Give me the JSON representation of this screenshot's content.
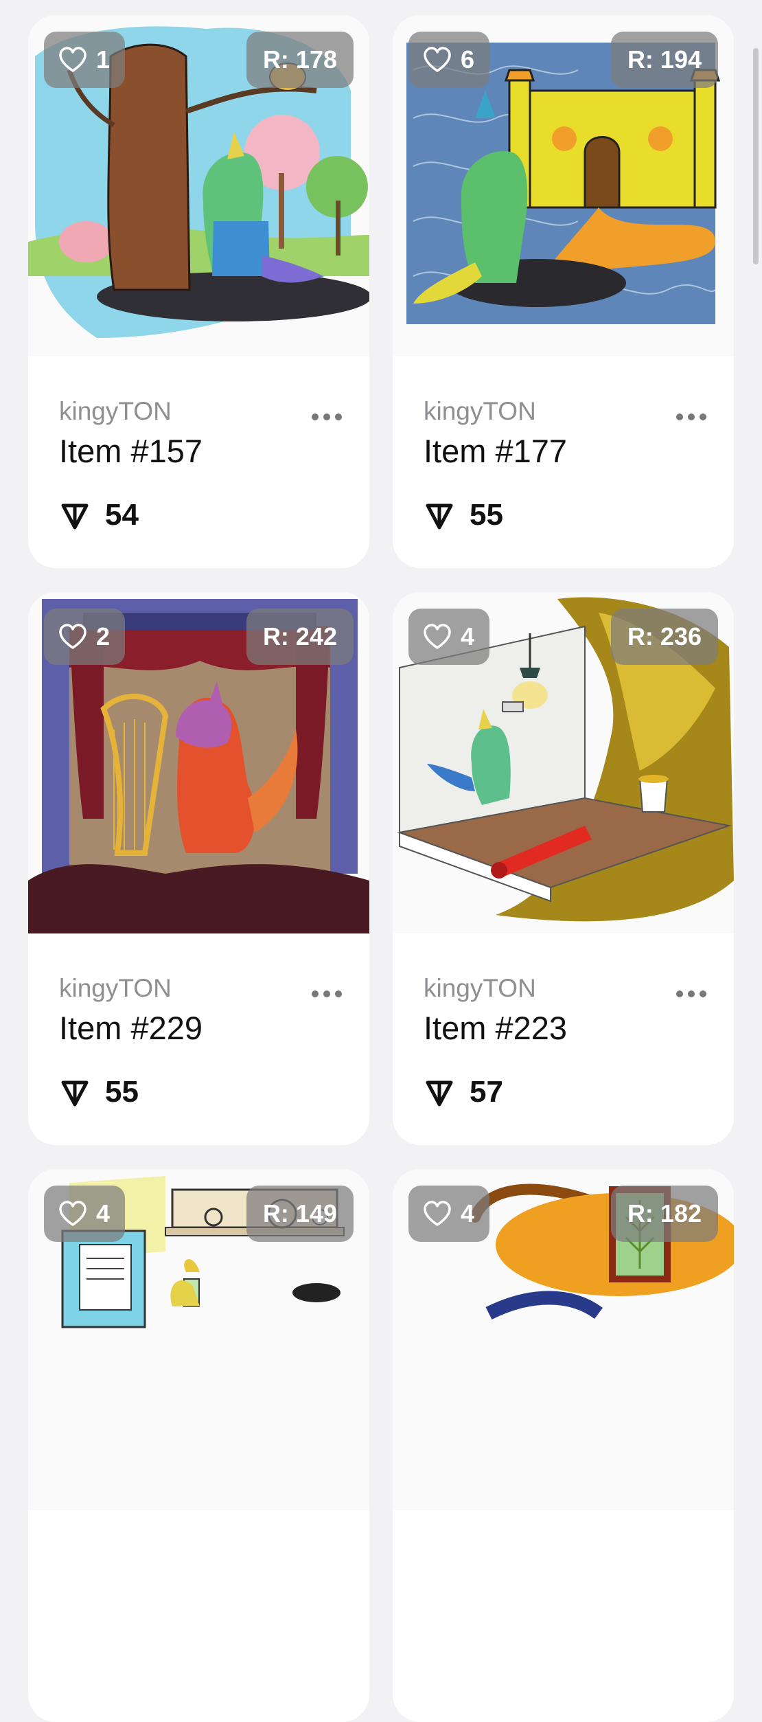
{
  "items": [
    {
      "creator": "kingyTON",
      "title": "Item #157",
      "likes": "1",
      "rank": "R: 178",
      "price": "54",
      "art": "tree-scene"
    },
    {
      "creator": "kingyTON",
      "title": "Item #177",
      "likes": "6",
      "rank": "R: 194",
      "price": "55",
      "art": "castle-scene"
    },
    {
      "creator": "kingyTON",
      "title": "Item #229",
      "likes": "2",
      "rank": "R: 242",
      "price": "55",
      "art": "theater-harp-scene"
    },
    {
      "creator": "kingyTON",
      "title": "Item #223",
      "likes": "4",
      "rank": "R: 236",
      "price": "57",
      "art": "painting-room-scene"
    },
    {
      "creator": "",
      "title": "",
      "likes": "4",
      "rank": "R: 149",
      "price": "",
      "art": "kitchen-scene"
    },
    {
      "creator": "",
      "title": "",
      "likes": "4",
      "rank": "R: 182",
      "price": "",
      "art": "orange-blob-scene"
    }
  ],
  "icons": {
    "heart": "heart-icon",
    "ton": "ton-currency-icon",
    "more": "more-options-icon"
  },
  "colors": {
    "background": "#f2f2f4",
    "card": "#ffffff",
    "badge": "rgba(125,125,125,0.72)",
    "creator_text": "#8e8e93"
  }
}
